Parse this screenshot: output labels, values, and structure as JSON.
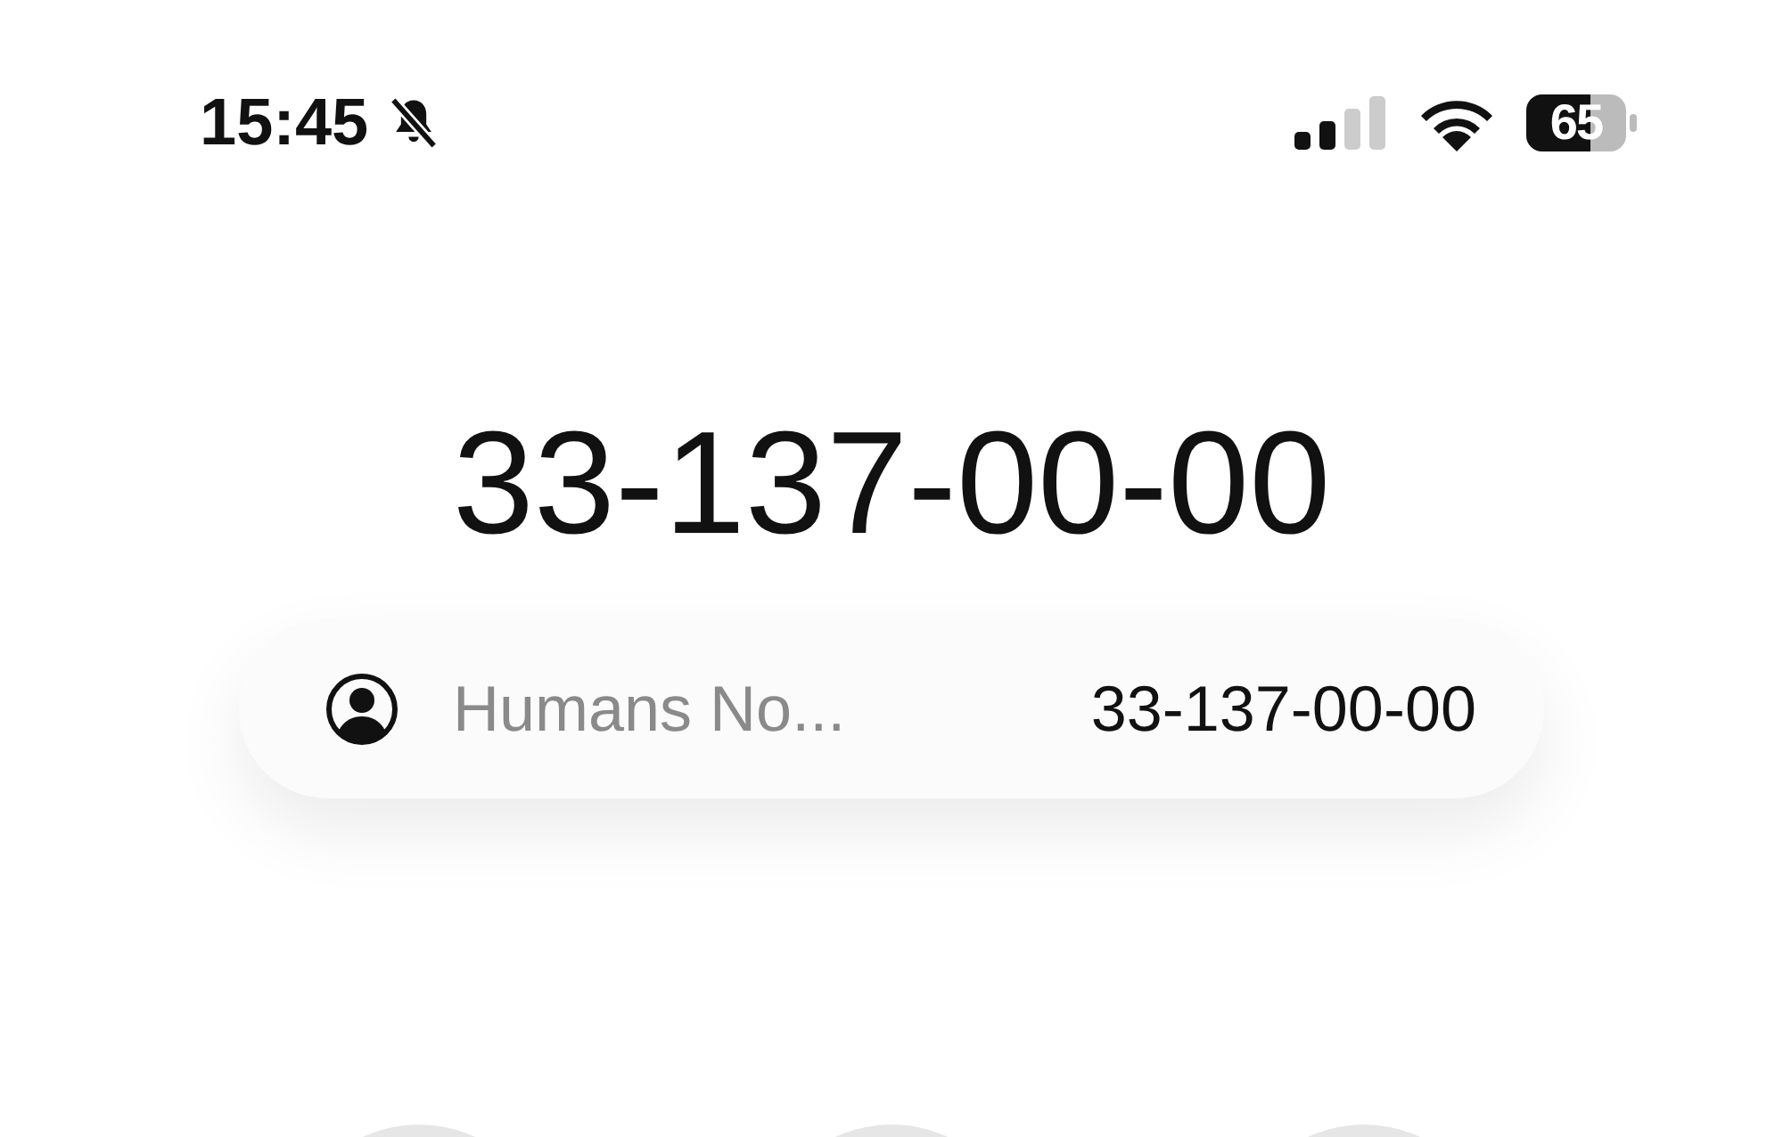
{
  "status_bar": {
    "time": "15:45",
    "battery": "65"
  },
  "dialed_number": "33-137-00-00",
  "suggestion": {
    "name": "Humans No...",
    "number": "33-137-00-00"
  },
  "keypad": [
    {
      "kind": "key"
    },
    {
      "kind": "key"
    },
    {
      "kind": "key"
    }
  ]
}
